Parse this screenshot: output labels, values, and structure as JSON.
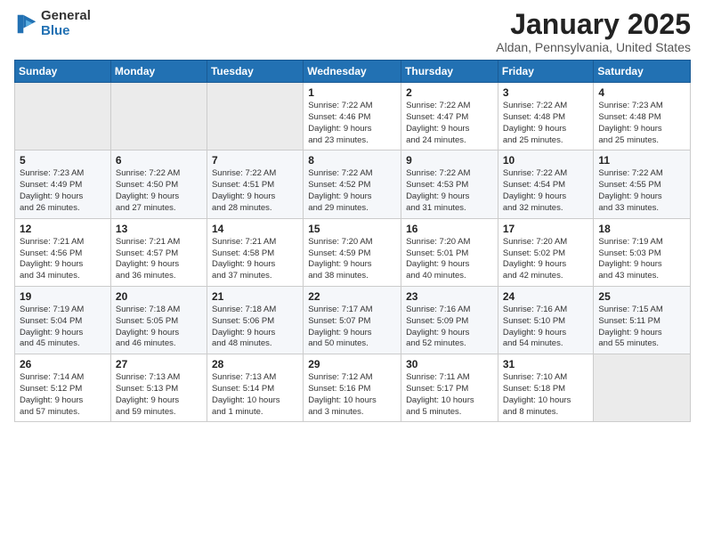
{
  "header": {
    "logo_general": "General",
    "logo_blue": "Blue",
    "month_title": "January 2025",
    "location": "Aldan, Pennsylvania, United States"
  },
  "days_of_week": [
    "Sunday",
    "Monday",
    "Tuesday",
    "Wednesday",
    "Thursday",
    "Friday",
    "Saturday"
  ],
  "weeks": [
    [
      {
        "day": "",
        "info": ""
      },
      {
        "day": "",
        "info": ""
      },
      {
        "day": "",
        "info": ""
      },
      {
        "day": "1",
        "info": "Sunrise: 7:22 AM\nSunset: 4:46 PM\nDaylight: 9 hours\nand 23 minutes."
      },
      {
        "day": "2",
        "info": "Sunrise: 7:22 AM\nSunset: 4:47 PM\nDaylight: 9 hours\nand 24 minutes."
      },
      {
        "day": "3",
        "info": "Sunrise: 7:22 AM\nSunset: 4:48 PM\nDaylight: 9 hours\nand 25 minutes."
      },
      {
        "day": "4",
        "info": "Sunrise: 7:23 AM\nSunset: 4:48 PM\nDaylight: 9 hours\nand 25 minutes."
      }
    ],
    [
      {
        "day": "5",
        "info": "Sunrise: 7:23 AM\nSunset: 4:49 PM\nDaylight: 9 hours\nand 26 minutes."
      },
      {
        "day": "6",
        "info": "Sunrise: 7:22 AM\nSunset: 4:50 PM\nDaylight: 9 hours\nand 27 minutes."
      },
      {
        "day": "7",
        "info": "Sunrise: 7:22 AM\nSunset: 4:51 PM\nDaylight: 9 hours\nand 28 minutes."
      },
      {
        "day": "8",
        "info": "Sunrise: 7:22 AM\nSunset: 4:52 PM\nDaylight: 9 hours\nand 29 minutes."
      },
      {
        "day": "9",
        "info": "Sunrise: 7:22 AM\nSunset: 4:53 PM\nDaylight: 9 hours\nand 31 minutes."
      },
      {
        "day": "10",
        "info": "Sunrise: 7:22 AM\nSunset: 4:54 PM\nDaylight: 9 hours\nand 32 minutes."
      },
      {
        "day": "11",
        "info": "Sunrise: 7:22 AM\nSunset: 4:55 PM\nDaylight: 9 hours\nand 33 minutes."
      }
    ],
    [
      {
        "day": "12",
        "info": "Sunrise: 7:21 AM\nSunset: 4:56 PM\nDaylight: 9 hours\nand 34 minutes."
      },
      {
        "day": "13",
        "info": "Sunrise: 7:21 AM\nSunset: 4:57 PM\nDaylight: 9 hours\nand 36 minutes."
      },
      {
        "day": "14",
        "info": "Sunrise: 7:21 AM\nSunset: 4:58 PM\nDaylight: 9 hours\nand 37 minutes."
      },
      {
        "day": "15",
        "info": "Sunrise: 7:20 AM\nSunset: 4:59 PM\nDaylight: 9 hours\nand 38 minutes."
      },
      {
        "day": "16",
        "info": "Sunrise: 7:20 AM\nSunset: 5:01 PM\nDaylight: 9 hours\nand 40 minutes."
      },
      {
        "day": "17",
        "info": "Sunrise: 7:20 AM\nSunset: 5:02 PM\nDaylight: 9 hours\nand 42 minutes."
      },
      {
        "day": "18",
        "info": "Sunrise: 7:19 AM\nSunset: 5:03 PM\nDaylight: 9 hours\nand 43 minutes."
      }
    ],
    [
      {
        "day": "19",
        "info": "Sunrise: 7:19 AM\nSunset: 5:04 PM\nDaylight: 9 hours\nand 45 minutes."
      },
      {
        "day": "20",
        "info": "Sunrise: 7:18 AM\nSunset: 5:05 PM\nDaylight: 9 hours\nand 46 minutes."
      },
      {
        "day": "21",
        "info": "Sunrise: 7:18 AM\nSunset: 5:06 PM\nDaylight: 9 hours\nand 48 minutes."
      },
      {
        "day": "22",
        "info": "Sunrise: 7:17 AM\nSunset: 5:07 PM\nDaylight: 9 hours\nand 50 minutes."
      },
      {
        "day": "23",
        "info": "Sunrise: 7:16 AM\nSunset: 5:09 PM\nDaylight: 9 hours\nand 52 minutes."
      },
      {
        "day": "24",
        "info": "Sunrise: 7:16 AM\nSunset: 5:10 PM\nDaylight: 9 hours\nand 54 minutes."
      },
      {
        "day": "25",
        "info": "Sunrise: 7:15 AM\nSunset: 5:11 PM\nDaylight: 9 hours\nand 55 minutes."
      }
    ],
    [
      {
        "day": "26",
        "info": "Sunrise: 7:14 AM\nSunset: 5:12 PM\nDaylight: 9 hours\nand 57 minutes."
      },
      {
        "day": "27",
        "info": "Sunrise: 7:13 AM\nSunset: 5:13 PM\nDaylight: 9 hours\nand 59 minutes."
      },
      {
        "day": "28",
        "info": "Sunrise: 7:13 AM\nSunset: 5:14 PM\nDaylight: 10 hours\nand 1 minute."
      },
      {
        "day": "29",
        "info": "Sunrise: 7:12 AM\nSunset: 5:16 PM\nDaylight: 10 hours\nand 3 minutes."
      },
      {
        "day": "30",
        "info": "Sunrise: 7:11 AM\nSunset: 5:17 PM\nDaylight: 10 hours\nand 5 minutes."
      },
      {
        "day": "31",
        "info": "Sunrise: 7:10 AM\nSunset: 5:18 PM\nDaylight: 10 hours\nand 8 minutes."
      },
      {
        "day": "",
        "info": ""
      }
    ]
  ]
}
